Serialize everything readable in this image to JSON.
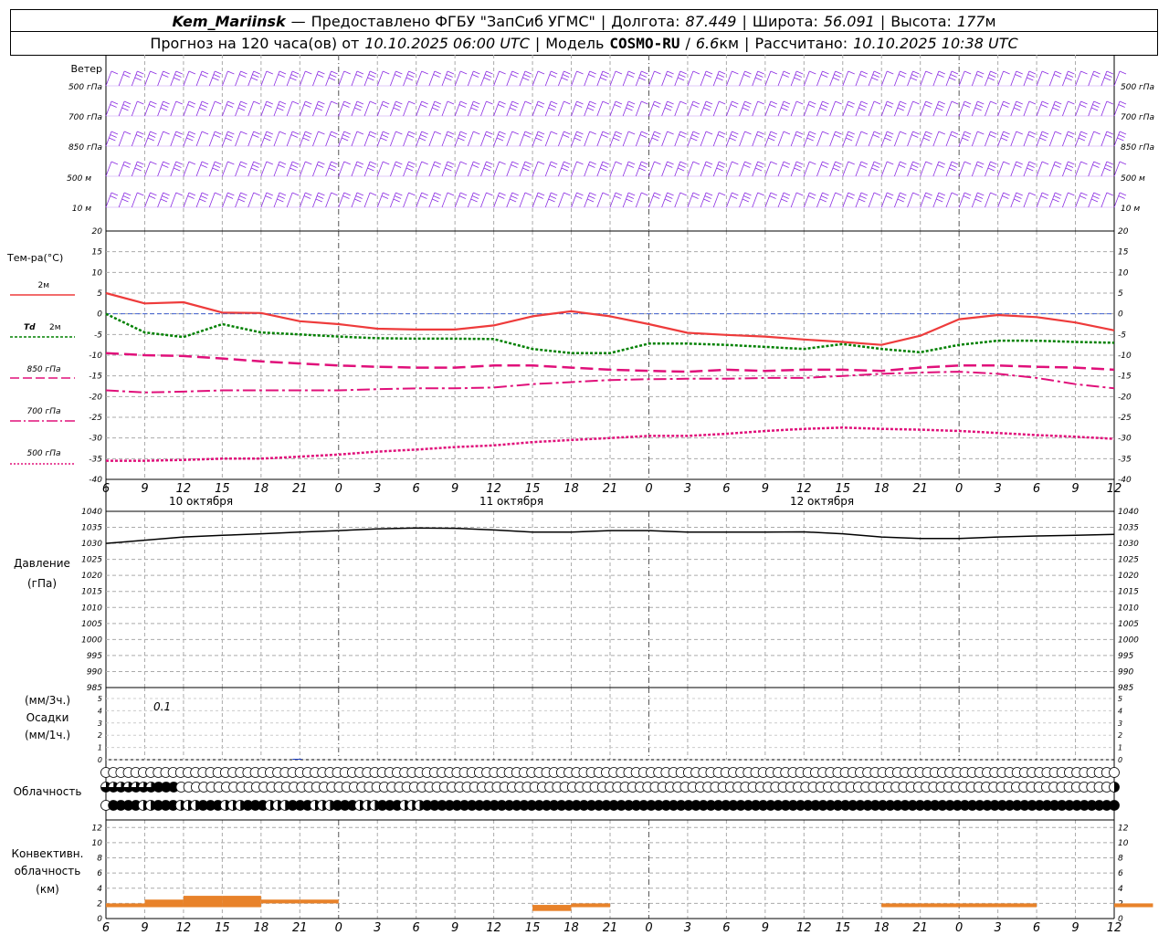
{
  "header": {
    "station": "Kem_Mariinsk",
    "dash": "—",
    "provided": "Предоставлено ФГБУ \"ЗапСиб УГМС\"",
    "sep": "|",
    "lon_label": "Долгота:",
    "lon_value": "87.449",
    "lat_label": "Широта:",
    "lat_value": "56.091",
    "alt_label": "Высота:",
    "alt_value": "177",
    "alt_unit": "м",
    "forecast_prefix": "Прогноз на 120 часа(ов) от",
    "forecast_start": "10.10.2025 06:00 UTC",
    "model_label": "Модель",
    "model_name": "COSMO-RU",
    "model_slash": "/",
    "model_res": "6.6",
    "model_res_unit": "км",
    "computed_label": "Рассчитано:",
    "computed_value": "10.10.2025 10:38 UTC"
  },
  "wind": {
    "title": "Ветер",
    "levels": [
      "500 гПа",
      "700 гПа",
      "850 гПа",
      "500 м",
      "10 м"
    ],
    "color": "#8a2be2"
  },
  "temperature": {
    "title": "Тем-ра(°С)",
    "legend": [
      {
        "label": "2м",
        "prefix": "",
        "color": "#ee3b3b",
        "dash": "solid"
      },
      {
        "label": "2м",
        "prefix": "Td",
        "color": "#008000",
        "dash": "dotted"
      },
      {
        "label": "850 гПа",
        "prefix": "",
        "color": "#e0107a",
        "dash": "long-dash"
      },
      {
        "label": "700 гПа",
        "prefix": "",
        "color": "#e0107a",
        "dash": "dash-dot"
      },
      {
        "label": "500 гПа",
        "prefix": "",
        "color": "#e0107a",
        "dash": "dotted"
      }
    ],
    "y_ticks": [
      "20",
      "15",
      "10",
      "5",
      "0",
      "-5",
      "-10",
      "-15",
      "-20",
      "-25",
      "-30",
      "-35",
      "-40"
    ]
  },
  "time_axis": {
    "tick_labels": [
      "6",
      "9",
      "12",
      "15",
      "18",
      "21",
      "0",
      "3",
      "6",
      "9",
      "12",
      "15",
      "18",
      "21",
      "0",
      "3",
      "6",
      "9",
      "12",
      "15",
      "18",
      "21",
      "0",
      "3",
      "6",
      "9",
      "12"
    ],
    "dates": [
      "10 октября",
      "11 октября",
      "12 октября"
    ]
  },
  "pressure": {
    "title": "Давление",
    "unit": "(гПа)",
    "y_ticks": [
      "1040",
      "1035",
      "1030",
      "1025",
      "1020",
      "1015",
      "1010",
      "1005",
      "1000",
      "995",
      "990",
      "985"
    ],
    "color": "#000000"
  },
  "precip": {
    "unit_top": "(мм/3ч.)",
    "title": "Осадки",
    "unit_bottom": "(мм/1ч.)",
    "y_ticks": [
      "5",
      "4",
      "3",
      "2",
      "1",
      "0"
    ],
    "annotation": "0.1"
  },
  "cloud": {
    "title": "Облачность",
    "rows": [
      "oooooooooooooooooooooooooooooooooooooooooooooooooooooooooooooooooooooooooooooooooooooooooooooooooooooooooooooooooooooooooooooooooooooooo",
      "3333333444o0oooooooooooooooooooooooooooooooooooooooooooooooooooooooooooooooooooooooooooooooooooooooooooooooooooooooooooooooooooooooooo2",
      "o444422444222444222444222444222444222444222444444444444444444444444444444444444444444444444444444444444444444444444444444444444444444444"
    ]
  },
  "convective": {
    "title_1": "Конвективн.",
    "title_2": "облачность",
    "unit": "(км)",
    "y_ticks": [
      "12",
      "10",
      "8",
      "6",
      "4",
      "2",
      "0"
    ],
    "color": "#e8822a"
  },
  "chart_data": [
    {
      "type": "line",
      "title": "Тем-ра(°С)",
      "x_hours_from_start": [
        0,
        3,
        6,
        9,
        12,
        15,
        18,
        21,
        24,
        27,
        30,
        33,
        36,
        39,
        42,
        45,
        48,
        51,
        54,
        57,
        60,
        63,
        66,
        69,
        72,
        75,
        78
      ],
      "ylim": [
        -40,
        20
      ],
      "series": [
        {
          "name": "2м",
          "values": [
            5,
            2.5,
            2.8,
            0.3,
            0.2,
            -1.8,
            -2.5,
            -3.6,
            -3.8,
            -3.8,
            -2.8,
            -0.6,
            0.6,
            -0.6,
            -2.5,
            -4.6,
            -5.1,
            -5.5,
            -6.2,
            -6.8,
            -7.5,
            -5.3,
            -1.3,
            -0.3,
            -0.8,
            -2.1,
            -4.0
          ]
        },
        {
          "name": "Td 2м",
          "values": [
            0,
            -4.5,
            -5.6,
            -2.5,
            -4.5,
            -5.0,
            -5.5,
            -5.9,
            -6.0,
            -6.0,
            -6.1,
            -8.5,
            -9.5,
            -9.5,
            -7.2,
            -7.2,
            -7.5,
            -8.0,
            -8.5,
            -7.3,
            -8.5,
            -9.3,
            -7.5,
            -6.5,
            -6.5,
            -6.8,
            -7.0
          ]
        },
        {
          "name": "850 гПа",
          "values": [
            -9.5,
            -10.0,
            -10.2,
            -10.8,
            -11.5,
            -12.0,
            -12.5,
            -12.8,
            -13.0,
            -13.0,
            -12.5,
            -12.5,
            -13.0,
            -13.5,
            -13.8,
            -14.0,
            -13.5,
            -13.8,
            -13.5,
            -13.5,
            -13.8,
            -13.0,
            -12.5,
            -12.5,
            -12.8,
            -13.0,
            -13.5
          ]
        },
        {
          "name": "700 гПа",
          "values": [
            -18.5,
            -19.0,
            -18.8,
            -18.5,
            -18.5,
            -18.5,
            -18.5,
            -18.2,
            -18.0,
            -18.0,
            -17.8,
            -17.0,
            -16.5,
            -16.0,
            -15.8,
            -15.7,
            -15.7,
            -15.5,
            -15.5,
            -15.0,
            -14.5,
            -14.2,
            -14.0,
            -14.5,
            -15.5,
            -17.0,
            -18.0
          ]
        },
        {
          "name": "500 гПа",
          "values": [
            -35.5,
            -35.5,
            -35.3,
            -35.0,
            -35.0,
            -34.5,
            -34.0,
            -33.3,
            -32.8,
            -32.2,
            -31.8,
            -31.0,
            -30.5,
            -30.0,
            -29.5,
            -29.5,
            -29.0,
            -28.3,
            -27.8,
            -27.5,
            -27.8,
            -28.0,
            -28.3,
            -28.8,
            -29.3,
            -29.7,
            -30.2
          ]
        }
      ]
    },
    {
      "type": "line",
      "title": "Давление",
      "x_hours_from_start": [
        0,
        3,
        6,
        9,
        12,
        15,
        18,
        21,
        24,
        27,
        30,
        33,
        36,
        39,
        42,
        45,
        48,
        51,
        54,
        57,
        60,
        63,
        66,
        69,
        72,
        75,
        78
      ],
      "ylim": [
        985,
        1040
      ],
      "series": [
        {
          "name": "Давление",
          "values": [
            1030,
            1031,
            1032,
            1032.5,
            1033,
            1033.5,
            1034,
            1034.5,
            1034.8,
            1034.7,
            1034.2,
            1033.5,
            1033.5,
            1034,
            1034,
            1033.5,
            1033.5,
            1033.5,
            1033.6,
            1033,
            1032,
            1031.5,
            1031.5,
            1032,
            1032.3,
            1032.5,
            1032.8
          ]
        }
      ]
    },
    {
      "type": "bar",
      "title": "Конвективн. облачность",
      "x_hours_from_start": [
        0,
        3,
        6,
        9,
        12,
        15,
        18,
        21,
        24,
        27,
        30,
        33,
        36,
        39,
        42,
        45,
        48,
        51,
        54,
        57,
        60,
        63,
        66,
        69,
        72,
        75,
        78
      ],
      "ylim": [
        0,
        13
      ],
      "series": [
        {
          "name": "base_km",
          "values": [
            1.5,
            1.5,
            1.5,
            1.5,
            2,
            2,
            2,
            2,
            2,
            2,
            2,
            1,
            1.5,
            0,
            0,
            0,
            0,
            0,
            0,
            0,
            1.5,
            1.5,
            1.5,
            1.5,
            0,
            0,
            1.5
          ]
        },
        {
          "name": "top_km",
          "values": [
            2,
            2.5,
            3,
            3,
            2.5,
            2.5,
            2,
            2,
            2,
            2,
            2,
            1.8,
            2,
            0,
            0,
            0,
            0,
            0,
            0,
            0,
            2,
            2,
            2,
            2,
            0,
            0,
            2
          ]
        }
      ]
    }
  ]
}
